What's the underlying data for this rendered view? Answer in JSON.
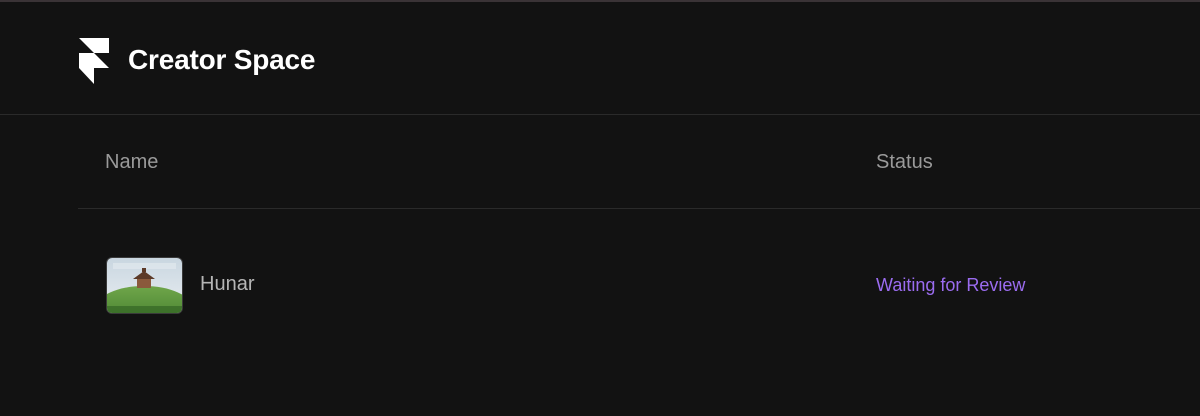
{
  "header": {
    "app_title": "Creator Space",
    "logo_icon": "framer-logo-icon"
  },
  "table": {
    "columns": [
      "Name",
      "Status"
    ],
    "rows": [
      {
        "name": "Hunar",
        "status": "Waiting for Review",
        "thumbnail_icon": "project-thumbnail"
      }
    ]
  },
  "colors": {
    "background": "#121212",
    "title": "#ffffff",
    "header_text": "#9a9a9a",
    "row_text": "#b5b5b5",
    "status_waiting": "#9b6cf0",
    "divider": "#2a2a2a"
  }
}
